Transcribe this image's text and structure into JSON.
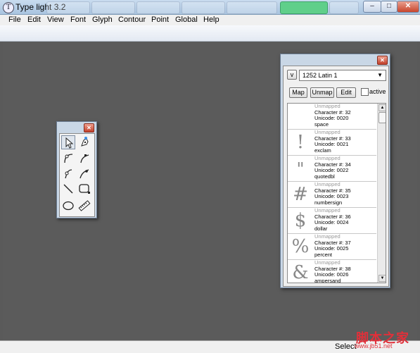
{
  "app": {
    "title": "Type light 3.2",
    "icon_glyph": "T"
  },
  "window_controls": {
    "minimize": "–",
    "maximize": "□",
    "close": "✕"
  },
  "menu": [
    "File",
    "Edit",
    "View",
    "Font",
    "Glyph",
    "Contour",
    "Point",
    "Global",
    "Help"
  ],
  "tool_palette": {
    "close": "✕",
    "tools": [
      {
        "name": "pointer-tool",
        "icon": "arrow-icon"
      },
      {
        "name": "pen-tool",
        "icon": "pen-nib-icon"
      },
      {
        "name": "curve-point-tool",
        "icon": "curve-point-icon"
      },
      {
        "name": "corner-point-tool",
        "icon": "corner-point-icon"
      },
      {
        "name": "tangent-point-tool",
        "icon": "tangent-point-icon"
      },
      {
        "name": "knife-tool",
        "icon": "knife-curve-icon"
      },
      {
        "name": "line-tool",
        "icon": "line-icon"
      },
      {
        "name": "rectangle-tool",
        "icon": "rounded-rect-icon"
      },
      {
        "name": "ellipse-tool",
        "icon": "ellipse-icon"
      },
      {
        "name": "measure-tool",
        "icon": "ruler-icon"
      }
    ]
  },
  "char_map": {
    "close": "✕",
    "dropdown_glyph": "v",
    "encoding": "1252 Latin 1",
    "buttons": {
      "map": "Map",
      "unmap": "Unmap",
      "edit": "Edit"
    },
    "active_label": "active",
    "active_checked": false,
    "rows": [
      {
        "glyph": "",
        "status": "Unmapped",
        "char": "Character #: 32",
        "unicode": "Unicode: 0020",
        "name": "space"
      },
      {
        "glyph": "!",
        "status": "Unmapped",
        "char": "Character #: 33",
        "unicode": "Unicode: 0021",
        "name": "exclam"
      },
      {
        "glyph": "\"",
        "status": "Unmapped",
        "char": "Character #: 34",
        "unicode": "Unicode: 0022",
        "name": "quotedbl"
      },
      {
        "glyph": "#",
        "status": "Unmapped",
        "char": "Character #: 35",
        "unicode": "Unicode: 0023",
        "name": "numbersign"
      },
      {
        "glyph": "$",
        "status": "Unmapped",
        "char": "Character #: 36",
        "unicode": "Unicode: 0024",
        "name": "dollar"
      },
      {
        "glyph": "%",
        "status": "Unmapped",
        "char": "Character #: 37",
        "unicode": "Unicode: 0025",
        "name": "percent"
      },
      {
        "glyph": "&",
        "status": "Unmapped",
        "char": "Character #: 38",
        "unicode": "Unicode: 0026",
        "name": "ampersand"
      }
    ]
  },
  "status": {
    "text": "Select"
  },
  "watermark": {
    "cn": "脚本之家",
    "url": "www.jb51.net"
  },
  "colors": {
    "workspace": "#5b5b5b",
    "close_red": "#c8452b",
    "titlebar": "#b8cfe7"
  }
}
